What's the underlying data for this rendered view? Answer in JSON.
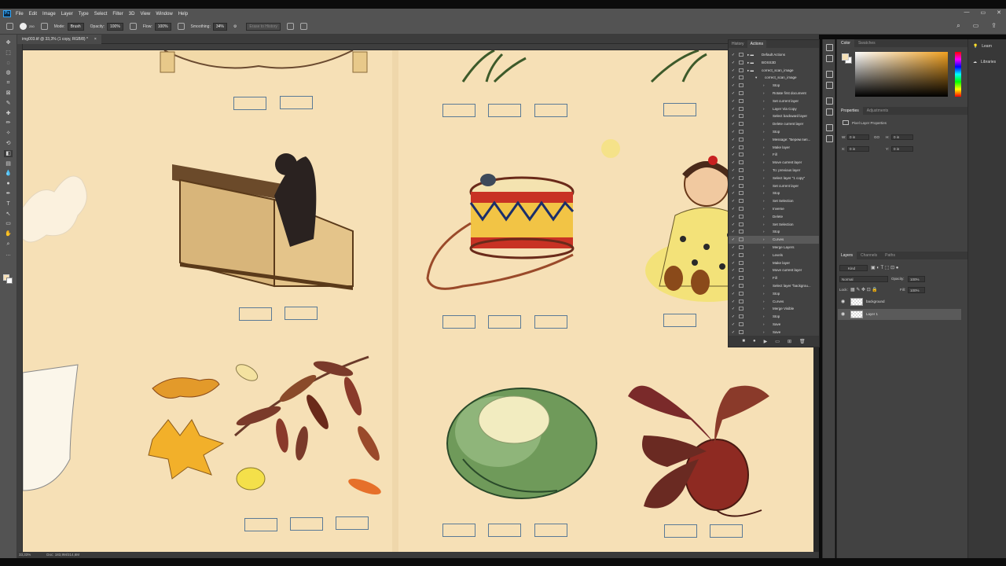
{
  "app": {
    "logo": "Ps"
  },
  "menu": [
    "File",
    "Edit",
    "Image",
    "Layer",
    "Type",
    "Select",
    "Filter",
    "3D",
    "View",
    "Window",
    "Help"
  ],
  "options": {
    "mode_label": "Mode:",
    "mode_value": "Brush",
    "opacity_label": "Opacity:",
    "opacity_value": "100%",
    "flow_label": "Flow:",
    "flow_value": "100%",
    "smoothing_label": "Smoothing:",
    "smoothing_value": "34%",
    "erase_history": "Erase to History",
    "brush_size": "250"
  },
  "document": {
    "tab_title": "img003.tif @ 33,3% (1 copy, RGB/8) *",
    "close": "×"
  },
  "status": {
    "zoom": "33,33%",
    "doc": "Doc: 183,9M/314,6M"
  },
  "actions_panel": {
    "tabs": [
      "History",
      "Actions"
    ],
    "rows": [
      {
        "label": "Default Actions",
        "indent": 0,
        "type": "folder"
      },
      {
        "label": "BOSS3D",
        "indent": 0,
        "type": "folder"
      },
      {
        "label": "correct_scan_image",
        "indent": 0,
        "type": "folder"
      },
      {
        "label": "correct_scan_image",
        "indent": 1,
        "type": "action"
      },
      {
        "label": "Stop",
        "indent": 2
      },
      {
        "label": "Rotate first document",
        "indent": 2
      },
      {
        "label": "Set current layer",
        "indent": 2
      },
      {
        "label": "Layer Via Copy",
        "indent": 2
      },
      {
        "label": "Select backward layer",
        "indent": 2
      },
      {
        "label": "Delete current layer",
        "indent": 2
      },
      {
        "label": "Stop",
        "indent": 2
      },
      {
        "label": "Message: \"Берем пип...",
        "indent": 2
      },
      {
        "label": "Make layer",
        "indent": 2
      },
      {
        "label": "Fill",
        "indent": 2
      },
      {
        "label": "Move current layer",
        "indent": 2
      },
      {
        "label": "To: previous layer",
        "indent": 2
      },
      {
        "label": "Select layer \"1 copy\"",
        "indent": 2
      },
      {
        "label": "Set current layer",
        "indent": 2
      },
      {
        "label": "Stop",
        "indent": 2
      },
      {
        "label": "Set Selection",
        "indent": 2
      },
      {
        "label": "Inverse",
        "indent": 2
      },
      {
        "label": "Delete",
        "indent": 2
      },
      {
        "label": "Set Selection",
        "indent": 2
      },
      {
        "label": "Stop",
        "indent": 2
      },
      {
        "label": "Curves",
        "indent": 2,
        "selected": true
      },
      {
        "label": "Merge Layers",
        "indent": 2
      },
      {
        "label": "Levels",
        "indent": 2
      },
      {
        "label": "Make layer",
        "indent": 2
      },
      {
        "label": "Move current layer",
        "indent": 2
      },
      {
        "label": "Fill",
        "indent": 2
      },
      {
        "label": "Select layer \"backgrou...",
        "indent": 2
      },
      {
        "label": "Stop",
        "indent": 2
      },
      {
        "label": "Curves",
        "indent": 2
      },
      {
        "label": "Merge Visible",
        "indent": 2
      },
      {
        "label": "Stop",
        "indent": 2
      },
      {
        "label": "Save",
        "indent": 2
      },
      {
        "label": "Save",
        "indent": 2
      }
    ],
    "footer": [
      "■",
      "●",
      "▶",
      "▭",
      "⊞",
      "🗑"
    ]
  },
  "color_panel": {
    "tabs": [
      "Color",
      "Swatches"
    ],
    "fg": "#f6e0b6",
    "bg": "#ffffff"
  },
  "properties_panel": {
    "tabs": [
      "Properties",
      "Adjustments"
    ],
    "title": "Pixel Layer Properties",
    "w_label": "W:",
    "w_value": "0 in",
    "h_label": "H:",
    "h_value": "0 in",
    "x_label": "X:",
    "x_value": "0 in",
    "y_label": "Y:",
    "y_value": "0 in",
    "link": "GO"
  },
  "layers_panel": {
    "tabs": [
      "Layers",
      "Channels",
      "Paths"
    ],
    "kind": "Kind",
    "blend": "Normal",
    "opacity_label": "Opacity:",
    "opacity_value": "100%",
    "lock_label": "Lock:",
    "fill_label": "Fill:",
    "fill_value": "100%",
    "layers": [
      {
        "name": "background"
      },
      {
        "name": "Layer 1",
        "selected": true
      }
    ]
  },
  "learn_panel": {
    "items": [
      "Learn",
      "Libraries"
    ]
  }
}
